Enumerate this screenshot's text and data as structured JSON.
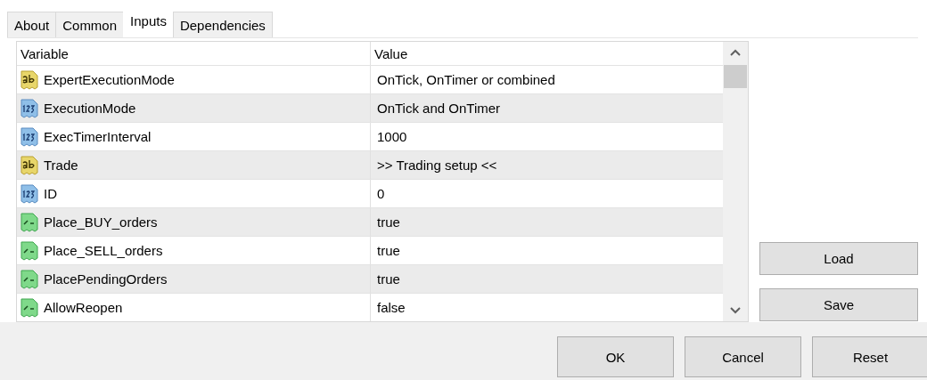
{
  "tabs": [
    {
      "label": "About",
      "selected": false
    },
    {
      "label": "Common",
      "selected": false
    },
    {
      "label": "Inputs",
      "selected": true
    },
    {
      "label": "Dependencies",
      "selected": false
    }
  ],
  "table": {
    "columns": [
      "Variable",
      "Value"
    ],
    "rows": [
      {
        "kind": "string",
        "variable": "ExpertExecutionMode",
        "value": "OnTick, OnTimer or combined"
      },
      {
        "kind": "number",
        "variable": "ExecutionMode",
        "value": "OnTick and OnTimer"
      },
      {
        "kind": "number",
        "variable": "ExecTimerInterval",
        "value": "1000"
      },
      {
        "kind": "string",
        "variable": "Trade",
        "value": ">> Trading setup <<"
      },
      {
        "kind": "number",
        "variable": "ID",
        "value": "0"
      },
      {
        "kind": "bool",
        "variable": "Place_BUY_orders",
        "value": "true"
      },
      {
        "kind": "bool",
        "variable": "Place_SELL_orders",
        "value": "true"
      },
      {
        "kind": "bool",
        "variable": "PlacePendingOrders",
        "value": "true"
      },
      {
        "kind": "bool",
        "variable": "AllowReopen",
        "value": "false"
      }
    ]
  },
  "side_buttons": [
    "Load",
    "Save"
  ],
  "buttons": [
    "OK",
    "Cancel",
    "Reset"
  ]
}
